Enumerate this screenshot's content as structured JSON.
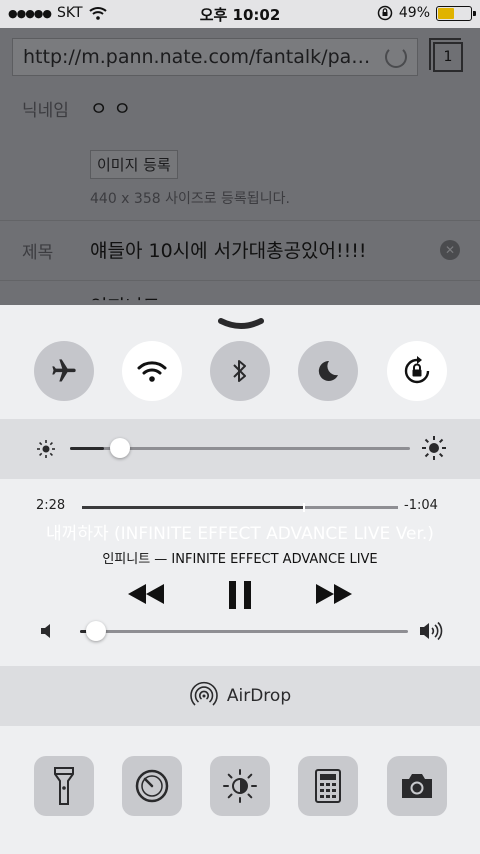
{
  "status_bar": {
    "carrier": "SKT",
    "time": "오후 10:02",
    "battery_percent": "49%",
    "battery_level": 0.49,
    "signal_dots": "●●●●●"
  },
  "browser": {
    "url": "http://m.pann.nate.com/fantalk/pann/w…",
    "tab_count": "1"
  },
  "form": {
    "nickname_label": "닉네임",
    "nickname_value": "ㅇㅇ",
    "image_button": "이미지 등록",
    "image_hint": "440 x 358 사이즈로 등록됩니다.",
    "title_label": "제목",
    "title_value": "얘들아 10시에 서가대총공있어!!!!",
    "next_row_partial": "인피니트"
  },
  "control_center": {
    "toggles": [
      {
        "name": "airplane-mode",
        "on": false
      },
      {
        "name": "wifi",
        "on": true
      },
      {
        "name": "bluetooth",
        "on": false
      },
      {
        "name": "do-not-disturb",
        "on": false
      },
      {
        "name": "rotation-lock",
        "on": true
      }
    ],
    "brightness": 0.1,
    "music": {
      "elapsed": "2:28",
      "remaining": "-1:04",
      "progress": 0.7,
      "title": "내꺼하자 (INFINITE EFFECT ADVANCE LIVE Ver.)",
      "artist_album": "인피니트 — INFINITE EFFECT ADVANCE LIVE"
    },
    "volume": 0.05,
    "airdrop_label": "AirDrop",
    "tools": [
      "flashlight",
      "timer",
      "night-shift",
      "calculator",
      "camera"
    ]
  },
  "colors": {
    "panel": "#eeeff1",
    "band": "#dcdde0",
    "toggle_off": "#c5c6cb",
    "toggle_on": "#ffffff",
    "battery": "#e0b300"
  }
}
